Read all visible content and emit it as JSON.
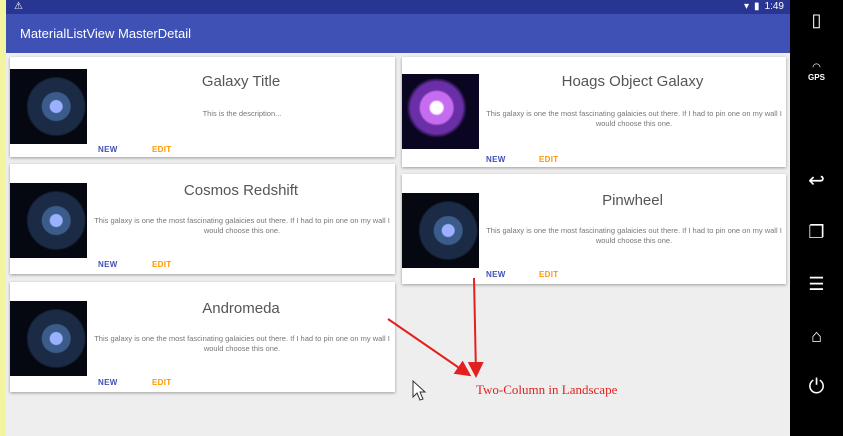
{
  "status_bar": {
    "time": "1:49",
    "warning_icon": "warning-icon",
    "wifi_icon": "wifi-icon",
    "battery_icon": "battery-icon"
  },
  "app_bar": {
    "title": "MaterialListView MasterDetail",
    "color": "#3f51b5"
  },
  "cards": [
    {
      "title": "Galaxy Title",
      "description": "This is the description...",
      "new_label": "NEW",
      "edit_label": "EDIT"
    },
    {
      "title": "Hoags Object  Galaxy",
      "description": "This galaxy  is one the most fascinating galaicies out there. If I had to pin one on my wall I would choose this one.",
      "new_label": "NEW",
      "edit_label": "EDIT"
    },
    {
      "title": "Cosmos Redshift",
      "description": "This galaxy  is one the most fascinating galaicies out there. If I had to pin one on my wall I would choose this one.",
      "new_label": "NEW",
      "edit_label": "EDIT"
    },
    {
      "title": "Pinwheel",
      "description": "This galaxy  is one the most fascinating galaicies out there. If I had to pin one on my wall I would choose this one.",
      "new_label": "NEW",
      "edit_label": "EDIT"
    },
    {
      "title": "Andromeda",
      "description": "This galaxy  is one the most fascinating galaicies out there. If I had to pin one on my wall I would choose this one.",
      "new_label": "NEW",
      "edit_label": "EDIT"
    }
  ],
  "annotation": {
    "text": "Two-Column in Landscape",
    "color": "#e32020"
  },
  "nav_panel": {
    "gps_label": "GPS",
    "icons": [
      "phone-icon",
      "gps-icon",
      "back-icon",
      "recents-icon",
      "menu-icon",
      "home-icon",
      "power-icon"
    ]
  }
}
